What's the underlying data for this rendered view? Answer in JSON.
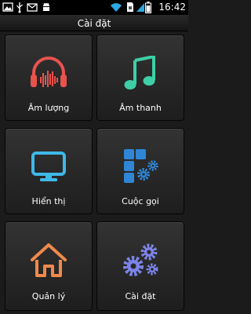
{
  "status_bar": {
    "time": "16:42",
    "icons": [
      "image-icon",
      "usb-icon",
      "mail-icon",
      "android-icon",
      "wifi-icon",
      "sim-icon",
      "signal-icon",
      "battery-icon"
    ]
  },
  "header": {
    "title": "Cài đặt"
  },
  "tiles": [
    {
      "label": "Âm lượng",
      "icon": "headphones-icon",
      "color": "#e8534e"
    },
    {
      "label": "Âm thanh",
      "icon": "music-note-icon",
      "color": "#3ecfa6"
    },
    {
      "label": "Hiển thị",
      "icon": "monitor-icon",
      "color": "#3fb8e8"
    },
    {
      "label": "Cuộc gọi",
      "icon": "apps-gear-icon",
      "color": "#2f86d6"
    },
    {
      "label": "Quản lý",
      "icon": "home-icon",
      "color": "#f0894c"
    },
    {
      "label": "Cài đặt",
      "icon": "gears-icon",
      "color": "#7c83e8"
    }
  ]
}
